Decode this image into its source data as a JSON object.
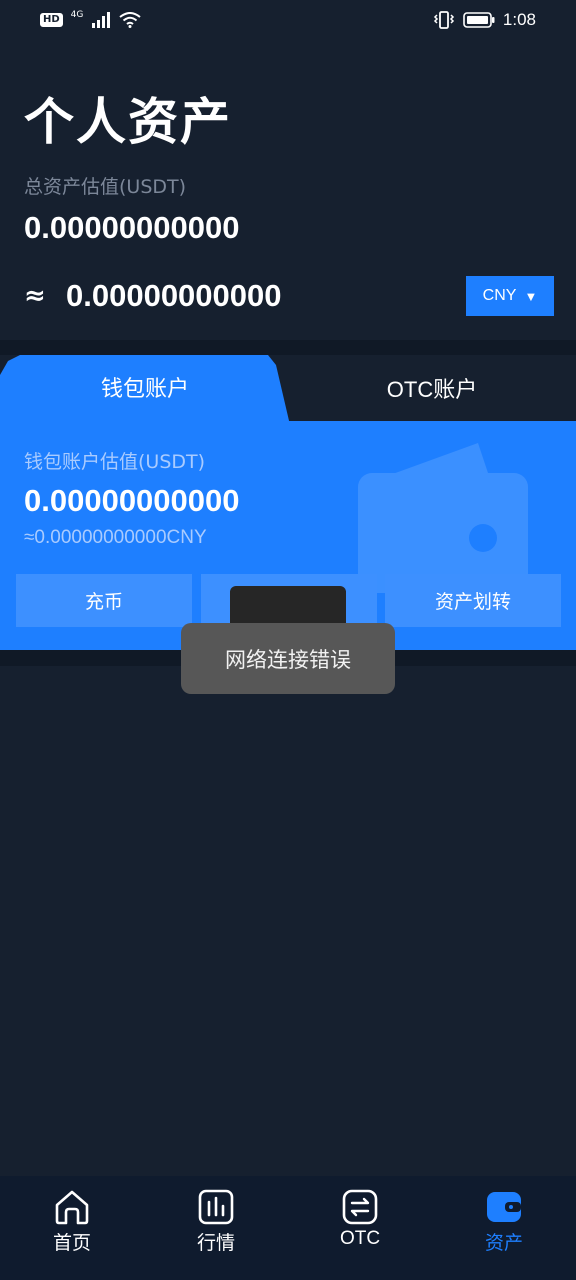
{
  "status_bar": {
    "hd": "HD",
    "network": "4G",
    "time": "1:08"
  },
  "header": {
    "title": "个人资产",
    "total_label": "总资产估值(USDT)",
    "total_value": "0.00000000000",
    "approx_sign": "≈",
    "approx_value": "0.00000000000",
    "currency": "CNY"
  },
  "tabs": [
    {
      "label": "钱包账户",
      "active": true
    },
    {
      "label": "OTC账户",
      "active": false
    }
  ],
  "wallet_card": {
    "label": "钱包账户估值(USDT)",
    "value": "0.00000000000",
    "sub_value": "≈0.00000000000CNY",
    "actions": [
      "充币",
      "",
      "资产划转"
    ]
  },
  "toast": {
    "message": "网络连接错误"
  },
  "bottom_nav": [
    {
      "label": "首页",
      "icon": "home-icon",
      "active": false
    },
    {
      "label": "行情",
      "icon": "market-icon",
      "active": false
    },
    {
      "label": "OTC",
      "icon": "otc-exchange-icon",
      "active": false
    },
    {
      "label": "资产",
      "icon": "wallet-icon",
      "active": true
    }
  ],
  "colors": {
    "background": "#16202f",
    "accent": "#1e7fff",
    "nav_background": "#0f1b2e"
  }
}
